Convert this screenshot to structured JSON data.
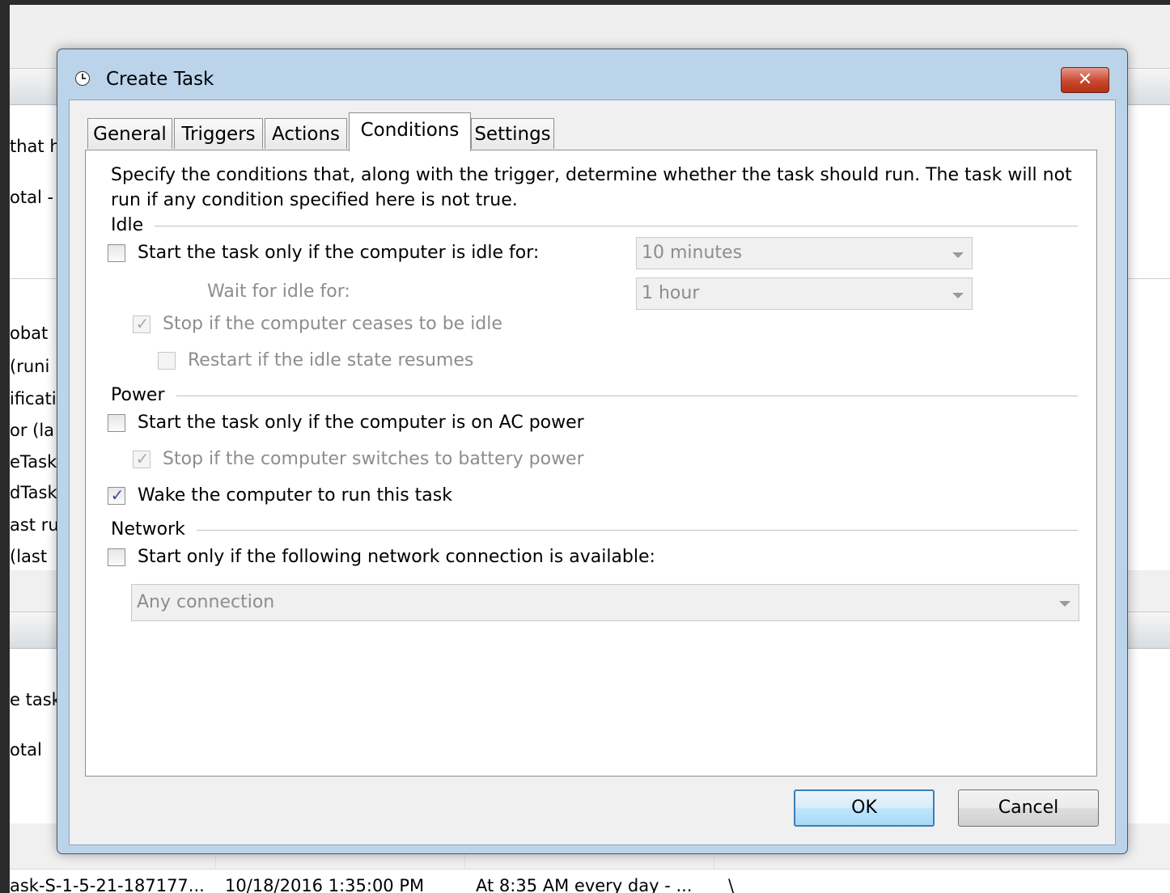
{
  "background": {
    "left_fragments": [
      "that h",
      "otal -",
      "obat",
      "(runi",
      "ificati",
      "or (la",
      "eTask",
      "dTask",
      "ast ru",
      "(last",
      "e task",
      "otal"
    ],
    "bottom_row": {
      "name": "ask-S-1-5-21-187177...",
      "next_run": "10/18/2016 1:35:00 PM",
      "trigger": "At 8:35 AM every day - ...",
      "location": "\\"
    }
  },
  "dialog": {
    "title": "Create Task",
    "close_glyph": "✕",
    "tabs": [
      "General",
      "Triggers",
      "Actions",
      "Conditions",
      "Settings"
    ],
    "active_tab": "Conditions",
    "description": [
      "Specify the conditions that, along with the trigger, determine whether the task should run.  The task will not",
      "run  if any condition specified here is not true."
    ],
    "idle": {
      "label": "Idle",
      "start_if_idle": {
        "label": "Start the task only if the computer is idle for:",
        "checked": false
      },
      "idle_duration": "10 minutes",
      "wait_label": "Wait for idle for:",
      "wait_duration": "1 hour",
      "stop_if_ceases": {
        "label": "Stop if the computer ceases to be idle",
        "checked": true,
        "enabled": false
      },
      "restart_if_resumes": {
        "label": "Restart if the idle state resumes",
        "checked": false,
        "enabled": false
      }
    },
    "power": {
      "label": "Power",
      "ac_power": {
        "label": "Start the task only if the computer is on AC power",
        "checked": false
      },
      "battery_stop": {
        "label": "Stop if the computer switches to battery power",
        "checked": true,
        "enabled": false
      },
      "wake": {
        "label": "Wake the computer to run this task",
        "checked": true
      }
    },
    "network": {
      "label": "Network",
      "start_only_if": {
        "label": "Start only if the following network connection is available:",
        "checked": false
      },
      "connection": "Any connection"
    },
    "buttons": {
      "ok": "OK",
      "cancel": "Cancel"
    },
    "check_glyph": "✓"
  }
}
